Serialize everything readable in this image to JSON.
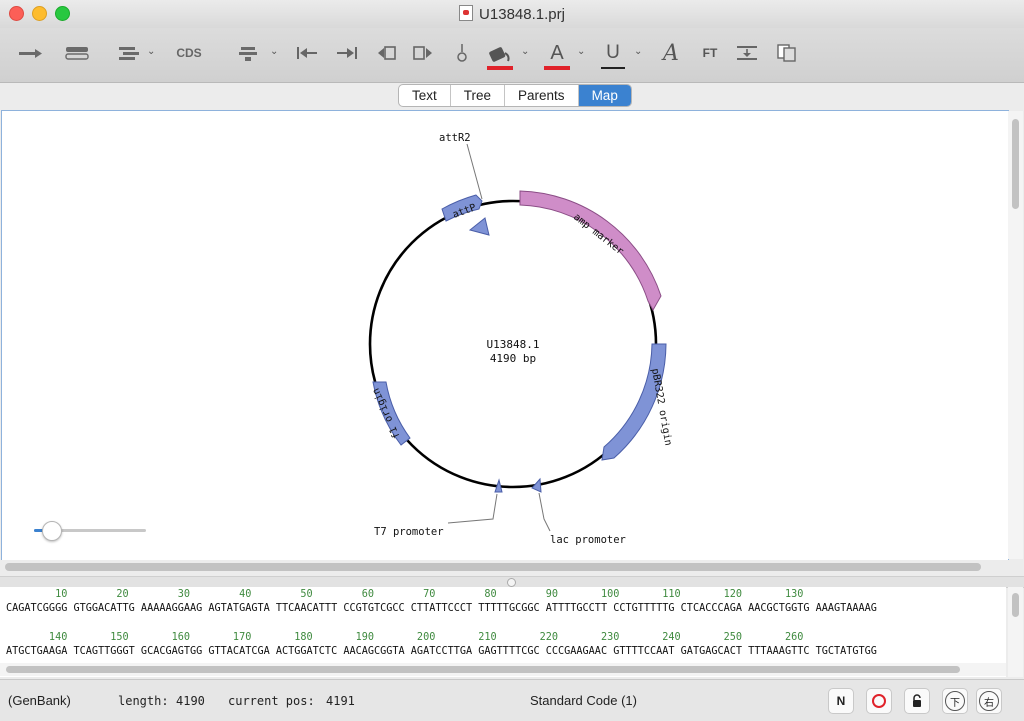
{
  "window": {
    "title": "U13848.1.prj"
  },
  "toolbar": {
    "cds_label": "CDS",
    "ft_label": "FT",
    "font_a_label": "A",
    "underline_label": "U",
    "italic_a_label": "A",
    "highlight_color": "#e0222a",
    "font_color": "#e0222a"
  },
  "tabs": [
    {
      "label": "Text",
      "active": false
    },
    {
      "label": "Tree",
      "active": false
    },
    {
      "label": "Parents",
      "active": false
    },
    {
      "label": "Map",
      "active": true
    }
  ],
  "map": {
    "name": "U13848.1",
    "length_label": "4190 bp",
    "features": [
      {
        "label": "attP",
        "color": "#7f93d6"
      },
      {
        "label": "amp marker",
        "color": "#cf8dc8"
      },
      {
        "label": "pBR322 origin",
        "color": "#7f93d6"
      },
      {
        "label": "f1 origin",
        "color": "#7f93d6"
      }
    ],
    "callouts": [
      {
        "label": "attR2"
      },
      {
        "label": "T7 promoter"
      },
      {
        "label": "lac promoter"
      }
    ]
  },
  "sequence": {
    "rows": [
      {
        "numbers": "        10        20        30        40        50        60        70        80        90       100       110       120       130",
        "bases": "CAGATCGGGG GTGGACATTG AAAAAGGAAG AGTATGAGTA TTCAACATTT CCGTGTCGCC CTTATTCCCT TTTTTGCGGC ATTTTGCCTT CCTGTTTTTG CTCACCCAGA AACGCTGGTG AAAGTAAAAG"
      },
      {
        "numbers": "       140       150       160       170       180       190       200       210       220       230       240       250       260",
        "bases": "ATGCTGAAGA TCAGTTGGGT GCACGAGTGG GTTACATCGA ACTGGATCTC AACAGCGGTA AGATCCTTGA GAGTTTTCGC CCCGAAGAAC GTTTTCCAAT GATGAGCACT TTTAAAGTTC TGCTATGTGG"
      }
    ]
  },
  "status": {
    "format": "(GenBank)",
    "length_label": "length:",
    "length_value": "4190",
    "pos_label": "current pos:",
    "pos_value": "4191",
    "code": "Standard Code (1)",
    "btn_n": "N",
    "btn_cjk1": "下",
    "btn_cjk2": "右"
  }
}
